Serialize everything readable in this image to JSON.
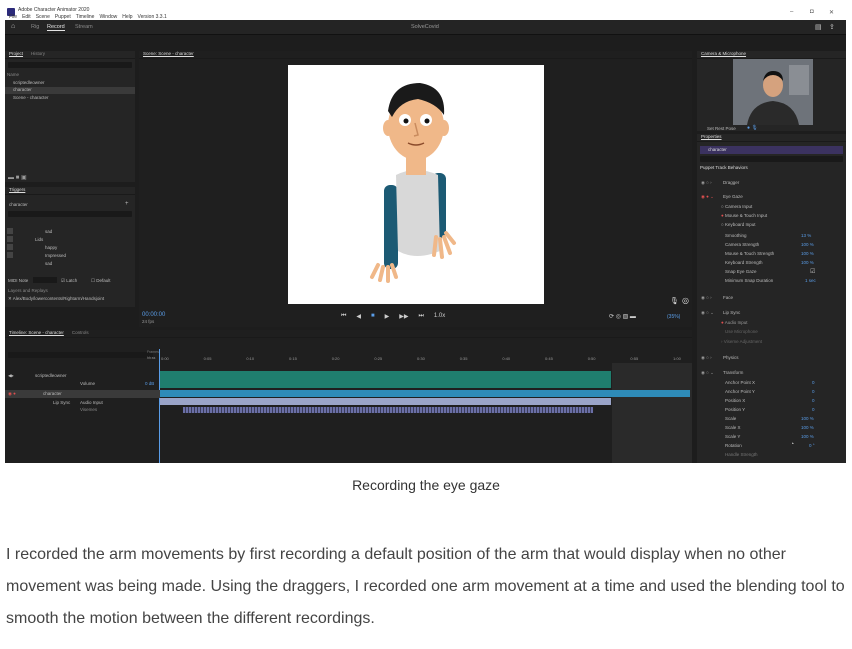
{
  "window": {
    "title": "Adobe Character Animator 2020",
    "menu": [
      "File",
      "Edit",
      "Scene",
      "Puppet",
      "Timeline",
      "Window",
      "Help",
      "Version 3.3.1"
    ],
    "minimize": "–",
    "maximize": "◘",
    "close": "✕"
  },
  "topnav": {
    "tabs": [
      "Rig",
      "Record",
      "Stream"
    ],
    "center_title": "SolveCovid"
  },
  "project": {
    "tabs": [
      "Project",
      "History"
    ],
    "name_header": "Name",
    "items": [
      "scriptedleowner",
      "character",
      "Scene - character"
    ]
  },
  "triggers": {
    "tab": "Triggers",
    "puppet": "character",
    "items": [
      "sad",
      "Lids",
      "happy",
      "Impressed",
      "sad"
    ],
    "midi_note": "MIDI Note",
    "latch": "Latch",
    "default": "Default",
    "layers_label": "Layers and Replays",
    "path": "Alex/Body/lowercontents/Rightarm/Handsjoint"
  },
  "scene_panel": {
    "tab": "Scene: Scene - character",
    "timecode": "00:00:00",
    "fps": "24 fps",
    "speed": "1.0x",
    "zoom": "(35%)"
  },
  "timeline": {
    "tabs": [
      "Timeline: Scene - character",
      "Controls"
    ],
    "frames_label": "Frames",
    "time_label": "hh:ss",
    "ruler": [
      "0:00",
      "0:05",
      "0:10",
      "0:15",
      "0:20",
      "0:25",
      "0:30",
      "0:35",
      "0:40",
      "0:45",
      "0:50",
      "0:55",
      "1:00"
    ],
    "tracks": [
      {
        "name": "scriptedleowner",
        "sub": "Volume",
        "value": "0 dB"
      },
      {
        "name": "character",
        "sub": "Lip Sync",
        "value": "Audio Input"
      },
      {
        "name": "",
        "sub": "",
        "value": "Visemes"
      }
    ]
  },
  "camera": {
    "tab": "Camera & Microphone",
    "set_rest": "Set Rest Pose"
  },
  "properties": {
    "tab": "Properties",
    "puppet": "character",
    "section": "Puppet Track Behaviors",
    "behaviors": [
      {
        "name": "Dragger",
        "rows": []
      },
      {
        "name": "Eye Gaze",
        "rows": [
          {
            "label": "Camera Input",
            "value": ""
          },
          {
            "label": "Mouse & Touch Input",
            "value": ""
          },
          {
            "label": "Keyboard Input",
            "value": ""
          },
          {
            "label": "Smoothing",
            "value": "13 %"
          },
          {
            "label": "Camera Strength",
            "value": "100 %"
          },
          {
            "label": "Mouse & Touch Strength",
            "value": "100 %"
          },
          {
            "label": "Keyboard Strength",
            "value": "100 %"
          },
          {
            "label": "Snap Eye Gaze",
            "value": "☑"
          },
          {
            "label": "Minimum Snap Duration",
            "value": "1 sec"
          }
        ]
      },
      {
        "name": "Face",
        "rows": []
      },
      {
        "name": "Lip Sync",
        "rows": [
          {
            "label": "Audio Input",
            "value": ""
          },
          {
            "label": "Use Microphone",
            "value": ""
          },
          {
            "label": "Viseme Amount",
            "value": ""
          },
          {
            "label": "Viseme Adjustment",
            "value": ""
          }
        ]
      },
      {
        "name": "Physics",
        "rows": []
      },
      {
        "name": "Transform",
        "rows": [
          {
            "label": "Anchor Point X",
            "value": "0"
          },
          {
            "label": "Anchor Point Y",
            "value": "0"
          },
          {
            "label": "Position X",
            "value": "0"
          },
          {
            "label": "Position Y",
            "value": "0"
          },
          {
            "label": "Scale",
            "value": "100 %"
          },
          {
            "label": "Scale X",
            "value": "100 %"
          },
          {
            "label": "Scale Y",
            "value": "100 %"
          },
          {
            "label": "Rotation",
            "value": "0 °"
          },
          {
            "label": "Handle Strength",
            "value": ""
          }
        ]
      }
    ]
  },
  "caption": "Recording the eye gaze",
  "paragraph": "I recorded the arm movements by first recording a default position of the arm that would display when no other movement was being made. Using the draggers, I recorded one arm movement at a time and used the blending tool to smooth the motion between the different recordings.",
  "colors": {
    "accent": "#2680eb",
    "waveform": "#2fa38f",
    "selection": "#9aa4c8"
  }
}
